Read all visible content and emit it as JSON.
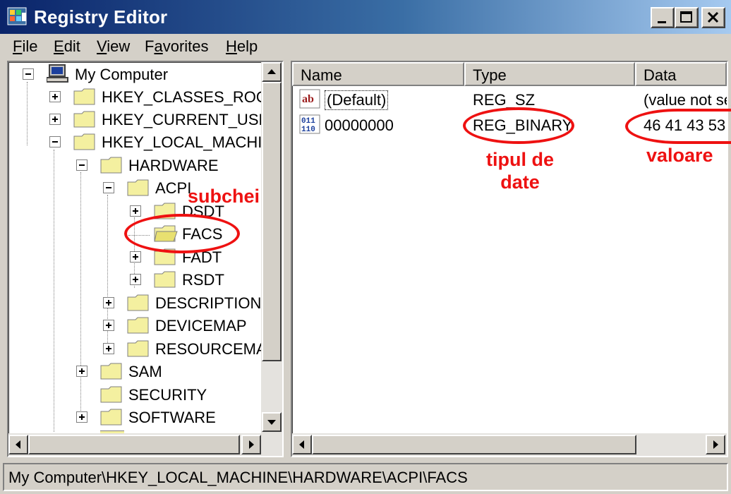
{
  "window": {
    "title": "Registry Editor"
  },
  "menu": [
    {
      "label_pre": "",
      "label_u": "F",
      "label_post": "ile"
    },
    {
      "label_pre": "",
      "label_u": "E",
      "label_post": "dit"
    },
    {
      "label_pre": "",
      "label_u": "V",
      "label_post": "iew"
    },
    {
      "label_pre": "F",
      "label_u": "a",
      "label_post": "vorites"
    },
    {
      "label_pre": "",
      "label_u": "H",
      "label_post": "elp"
    }
  ],
  "tree": {
    "root": "My Computer",
    "hives": [
      "HKEY_CLASSES_ROOT",
      "HKEY_CURRENT_USER",
      "HKEY_LOCAL_MACHINE"
    ],
    "hklm_children": [
      "HARDWARE",
      "SAM",
      "SECURITY",
      "SOFTWARE"
    ],
    "hardware_children": [
      "ACPI",
      "DESCRIPTION",
      "DEVICEMAP",
      "RESOURCEMAP"
    ],
    "acpi_children": [
      "DSDT",
      "FACS",
      "FADT",
      "RSDT"
    ]
  },
  "list": {
    "headers": [
      "Name",
      "Type",
      "Data"
    ],
    "rows": [
      {
        "name": "(Default)",
        "type": "REG_SZ",
        "data": "(value not set)",
        "icon": "string-value-icon"
      },
      {
        "name": "00000000",
        "type": "REG_BINARY",
        "data": "46 41 43 53",
        "icon": "binary-value-icon"
      }
    ]
  },
  "status": {
    "path": "My Computer\\HKEY_LOCAL_MACHINE\\HARDWARE\\ACPI\\FACS"
  },
  "annotations": {
    "subkeys": "subchei",
    "data_type_line1": "tipul de",
    "data_type_line2": "date",
    "value": "valoare",
    "color": "#ee1111"
  }
}
